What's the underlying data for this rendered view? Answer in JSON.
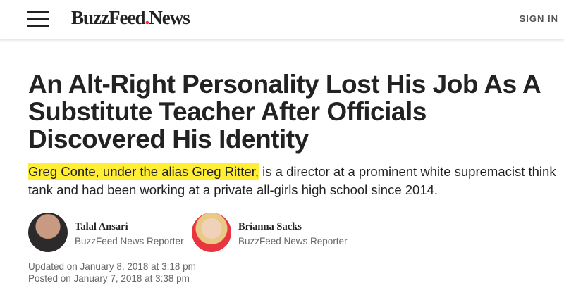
{
  "header": {
    "logo_main": "BuzzFeed",
    "logo_dot": ".",
    "logo_news": "News",
    "signin_label": "SIGN IN"
  },
  "article": {
    "headline": "An Alt-Right Personality Lost His Job As A Substitute Teacher After Officials Discovered His Identity",
    "dek_highlight": "Greg Conte, under the alias Greg Ritter,",
    "dek_rest": " is a director at a prominent white supremacist think tank and had been working at a private all-girls high school since 2014.",
    "authors": [
      {
        "name": "Talal Ansari",
        "role": "BuzzFeed News Reporter"
      },
      {
        "name": "Brianna Sacks",
        "role": "BuzzFeed News Reporter"
      }
    ],
    "updated": "Updated on January 8, 2018 at 3:18 pm",
    "posted": "Posted on January 7, 2018 at 3:38 pm"
  },
  "colors": {
    "logo_dot": "#ee3322",
    "highlight": "#ffee33",
    "text": "#222222",
    "muted": "#666666"
  },
  "icons": {
    "menu": "hamburger-menu-icon"
  }
}
